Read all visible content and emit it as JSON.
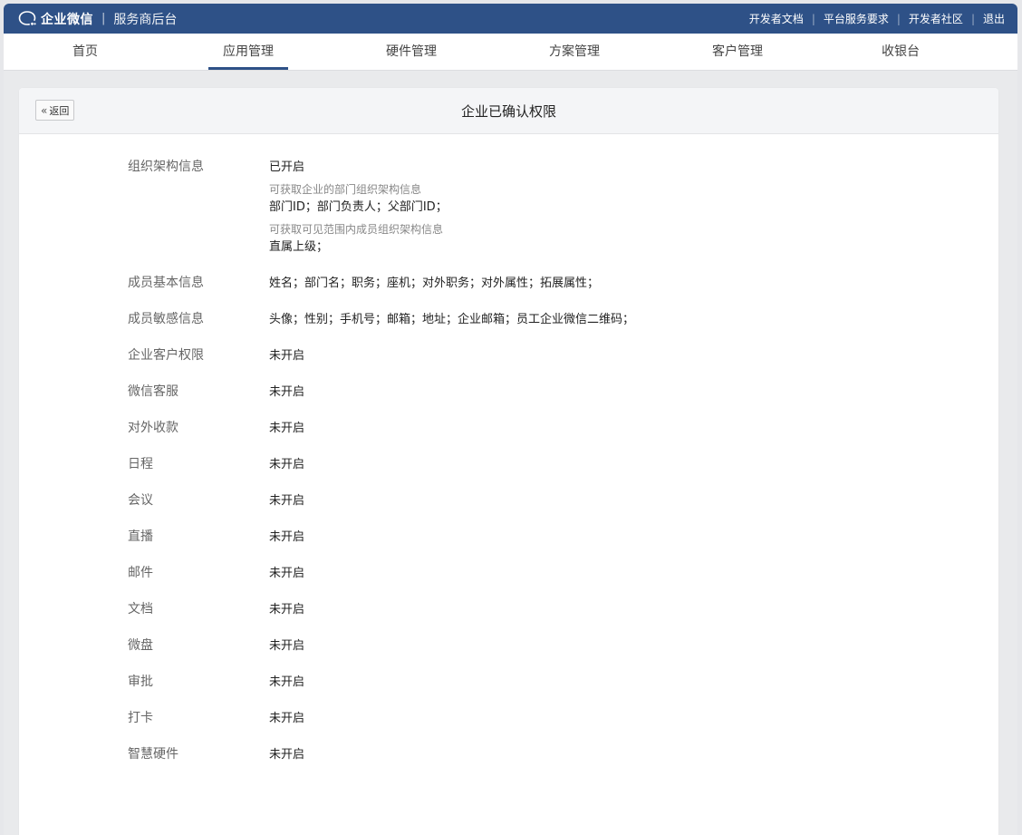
{
  "topbar": {
    "brand": "企业微信",
    "separator": "|",
    "subtitle": "服务商后台",
    "links": [
      "开发者文档",
      "平台服务要求",
      "开发者社区",
      "退出"
    ]
  },
  "nav": {
    "items": [
      "首页",
      "应用管理",
      "硬件管理",
      "方案管理",
      "客户管理",
      "收银台"
    ],
    "active_index": 1
  },
  "page": {
    "back_label": "返回",
    "title": "企业已确认权限"
  },
  "permissions": {
    "org": {
      "label": "组织架构信息",
      "status": "已开启",
      "desc1": "可获取企业的部门组织架构信息",
      "fields1": "部门ID；部门负责人；父部门ID；",
      "desc2": "可获取可见范围内成员组织架构信息",
      "fields2": "直属上级；"
    },
    "basic": {
      "label": "成员基本信息",
      "value": "姓名；部门名；职务；座机；对外职务；对外属性；拓展属性；"
    },
    "sensitive": {
      "label": "成员敏感信息",
      "value": "头像；性别；手机号；邮箱；地址；企业邮箱；员工企业微信二维码；"
    },
    "others": [
      {
        "label": "企业客户权限",
        "status": "未开启"
      },
      {
        "label": "微信客服",
        "status": "未开启"
      },
      {
        "label": "对外收款",
        "status": "未开启"
      },
      {
        "label": "日程",
        "status": "未开启"
      },
      {
        "label": "会议",
        "status": "未开启"
      },
      {
        "label": "直播",
        "status": "未开启"
      },
      {
        "label": "邮件",
        "status": "未开启"
      },
      {
        "label": "文档",
        "status": "未开启"
      },
      {
        "label": "微盘",
        "status": "未开启"
      },
      {
        "label": "审批",
        "status": "未开启"
      },
      {
        "label": "打卡",
        "status": "未开启"
      },
      {
        "label": "智慧硬件",
        "status": "未开启"
      }
    ]
  },
  "colors": {
    "topbar": "#2e5187",
    "active_underline": "#2e5187"
  }
}
